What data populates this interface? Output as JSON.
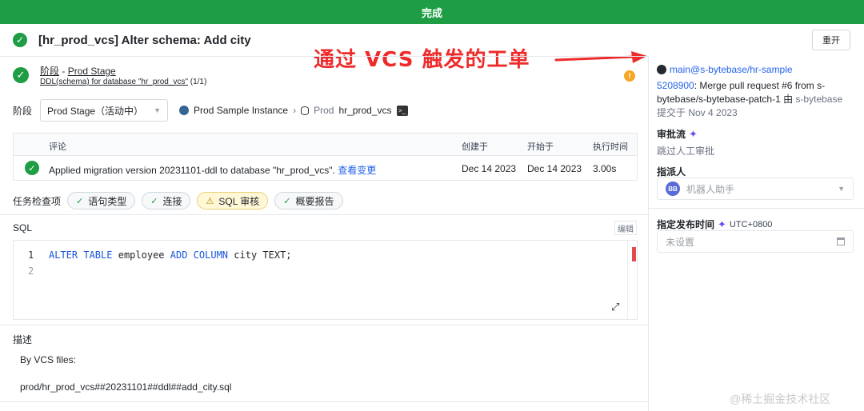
{
  "status_banner": "完成",
  "header": {
    "title": "[hr_prod_vcs] Alter schema: Add city",
    "reopen_label": "重开"
  },
  "annotation": {
    "text": "通过 VCS 触发的工单",
    "color": "#ee2b2b"
  },
  "stage": {
    "prefix": "阶段",
    "dash": " - ",
    "name": "Prod Stage",
    "task_link": "DDL(schema) for database \"hr_prod_vcs\"",
    "task_count": " (1/1)",
    "warning_icon": "!"
  },
  "stage_select": {
    "label": "阶段",
    "selected": "Prod Stage（活动中）",
    "instance": "Prod Sample Instance",
    "env": "Prod",
    "database": "hr_prod_vcs",
    "terminal_icon": ">_"
  },
  "table": {
    "headers": [
      "评论",
      "创建于",
      "开始于",
      "执行时间"
    ],
    "rows": [
      {
        "comment": "Applied migration version 20231101-ddl to database \"hr_prod_vcs\".",
        "link": "查看变更",
        "created": "Dec 14 2023",
        "started": "Dec 14 2023",
        "duration": "3.00s"
      }
    ]
  },
  "task_checks": {
    "label": "任务检查项",
    "items": [
      "语句类型",
      "连接",
      "SQL 审核",
      "概要报告"
    ]
  },
  "sql": {
    "label": "SQL",
    "edit_label": "编辑",
    "line_numbers": [
      "1",
      "2"
    ],
    "keywords": [
      "ALTER",
      "TABLE",
      "ADD",
      "COLUMN"
    ],
    "table_name": "employee",
    "column_def": "city TEXT;"
  },
  "description": {
    "label": "描述",
    "line1": "By VCS files:",
    "line2": "prod/hr_prod_vcs##20231101##ddl##add_city.sql"
  },
  "sidebar": {
    "repo": "main@s-bytebase/hr-sample",
    "commit_hash": "5208900",
    "commit_message": ": Merge pull request #6 from s-bytebase/s-bytebase-patch-1",
    "by_word": " 由 ",
    "author": "s-bytebase",
    "submitted": "提交于 Nov 4 2023",
    "approval_label": "审批流",
    "approval_value": "跳过人工审批",
    "assignee_label": "指派人",
    "assignee_initials": "BB",
    "assignee_name": "机器人助手",
    "schedule_label": "指定发布时间",
    "timezone": "UTC+0800",
    "schedule_placeholder": "未设置"
  },
  "watermark": "@稀土掘金技术社区"
}
